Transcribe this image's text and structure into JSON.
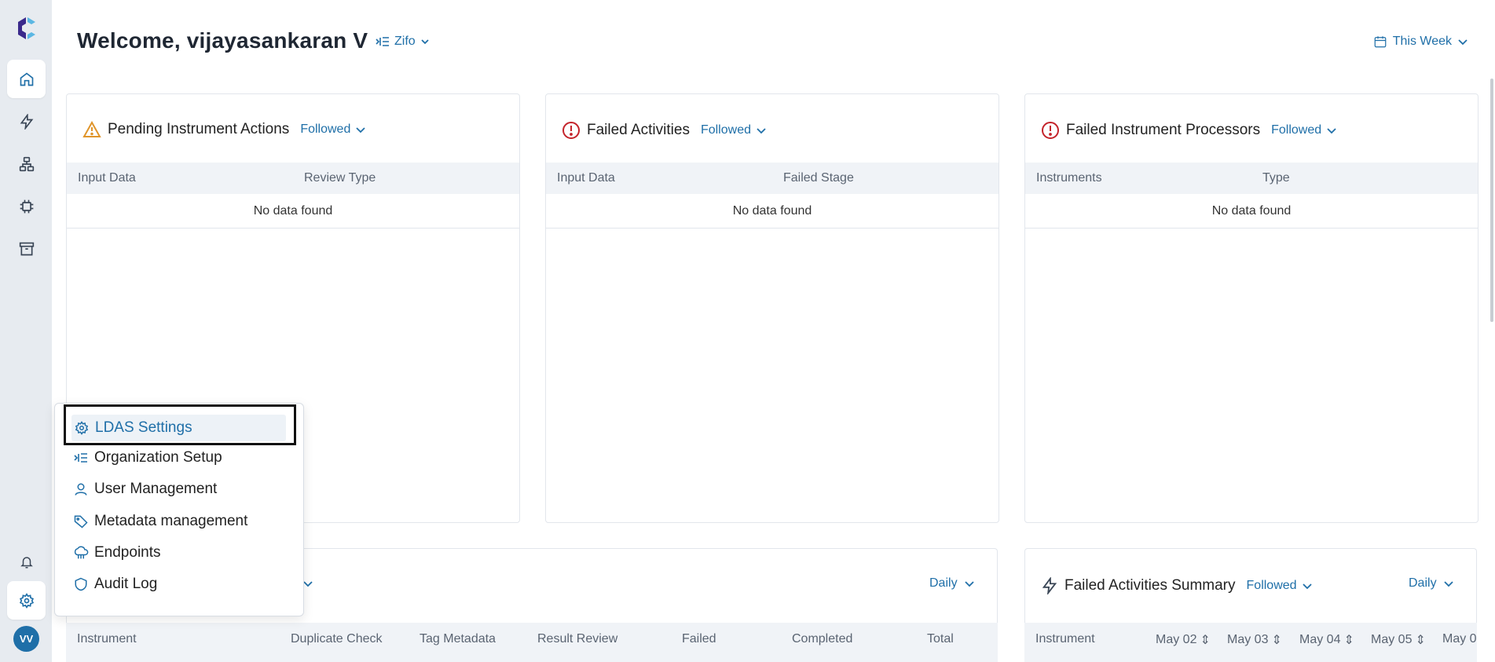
{
  "header": {
    "welcome": "Welcome, vijayasankaran V",
    "org": "Zifo",
    "period": "This Week"
  },
  "sidebar": {
    "items": [
      {
        "icon": "home-icon",
        "active": true
      },
      {
        "icon": "bolt-icon"
      },
      {
        "icon": "network-icon"
      },
      {
        "icon": "chip-icon"
      },
      {
        "icon": "archive-icon"
      }
    ],
    "bell": "bell-icon",
    "settings": "gear-icon",
    "avatar": "VV"
  },
  "cards": [
    {
      "title": "Pending Instrument Actions",
      "filter": "Followed",
      "icon": "warning-icon",
      "columns": [
        "Input Data",
        "Review Type"
      ],
      "empty": "No data found"
    },
    {
      "title": "Failed Activities",
      "filter": "Followed",
      "icon": "error-circle-icon",
      "columns": [
        "Input Data",
        "Failed Stage"
      ],
      "empty": "No data found"
    },
    {
      "title": "Failed Instrument Processors",
      "filter": "Followed",
      "icon": "error-circle-icon",
      "columns": [
        "Instruments",
        "Type"
      ],
      "empty": "No data found"
    }
  ],
  "bottom_left": {
    "period": "Daily",
    "columns": [
      "Instrument",
      "Duplicate Check",
      "Tag Metadata",
      "Result Review",
      "Failed",
      "Completed",
      "Total"
    ]
  },
  "bottom_right": {
    "title": "Failed Activities Summary",
    "filter": "Followed",
    "period": "Daily",
    "columns": [
      "Instrument",
      "May 02",
      "May 03",
      "May 04",
      "May 05",
      "May 0"
    ]
  },
  "menu": {
    "items": [
      {
        "label": "LDAS Settings",
        "icon": "gear-icon"
      },
      {
        "label": "Organization Setup",
        "icon": "org-list-icon"
      },
      {
        "label": "User Management",
        "icon": "user-icon"
      },
      {
        "label": "Metadata management",
        "icon": "tag-icon"
      },
      {
        "label": "Endpoints",
        "icon": "cloud-endpoint-icon"
      },
      {
        "label": "Audit Log",
        "icon": "shield-icon"
      }
    ]
  },
  "colors": {
    "accent": "#1f6fa8",
    "warning": "#e0952b",
    "error": "#c4242b"
  }
}
